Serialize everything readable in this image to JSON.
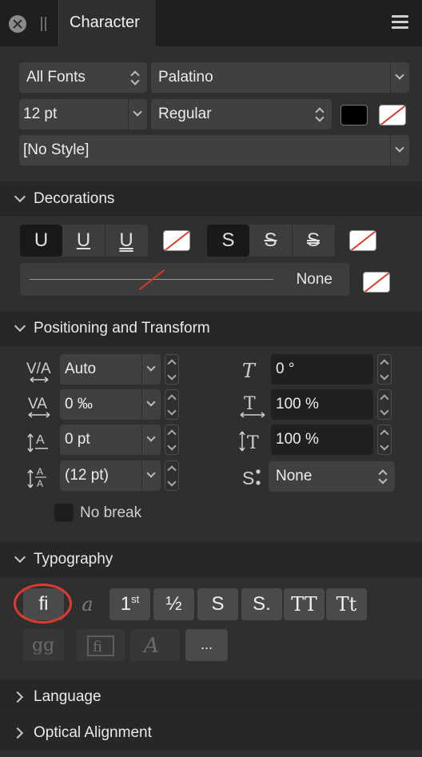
{
  "panel": {
    "title": "Character"
  },
  "font": {
    "collection": "All Fonts",
    "family": "Palatino",
    "size": "12 pt",
    "style": "Regular",
    "paragraph_style": "[No Style]",
    "text_color": "#000000"
  },
  "sections": {
    "decorations": "Decorations",
    "positioning": "Positioning and Transform",
    "typography": "Typography",
    "language": "Language",
    "optical": "Optical Alignment"
  },
  "decorations": {
    "underline_buttons": [
      "U",
      "U",
      "U"
    ],
    "strike_buttons": [
      "S",
      "S",
      "S"
    ],
    "line_value": "None"
  },
  "positioning": {
    "kerning": "Auto",
    "tracking": "0 ‰",
    "baseline": "0 pt",
    "leading": "(12 pt)",
    "shear": "0 °",
    "scale_h": "100 %",
    "scale_v": "100 %",
    "subscript": "None",
    "no_break": "No break"
  },
  "typography": {
    "row1": [
      "fi",
      "a",
      "1",
      "½",
      "S",
      "S.",
      "TT",
      "Tt"
    ],
    "ordinal_sup": "st",
    "more": "..."
  },
  "colors": {
    "accent_red": "#e03a2f",
    "panel_bg": "#2f2f2f"
  }
}
